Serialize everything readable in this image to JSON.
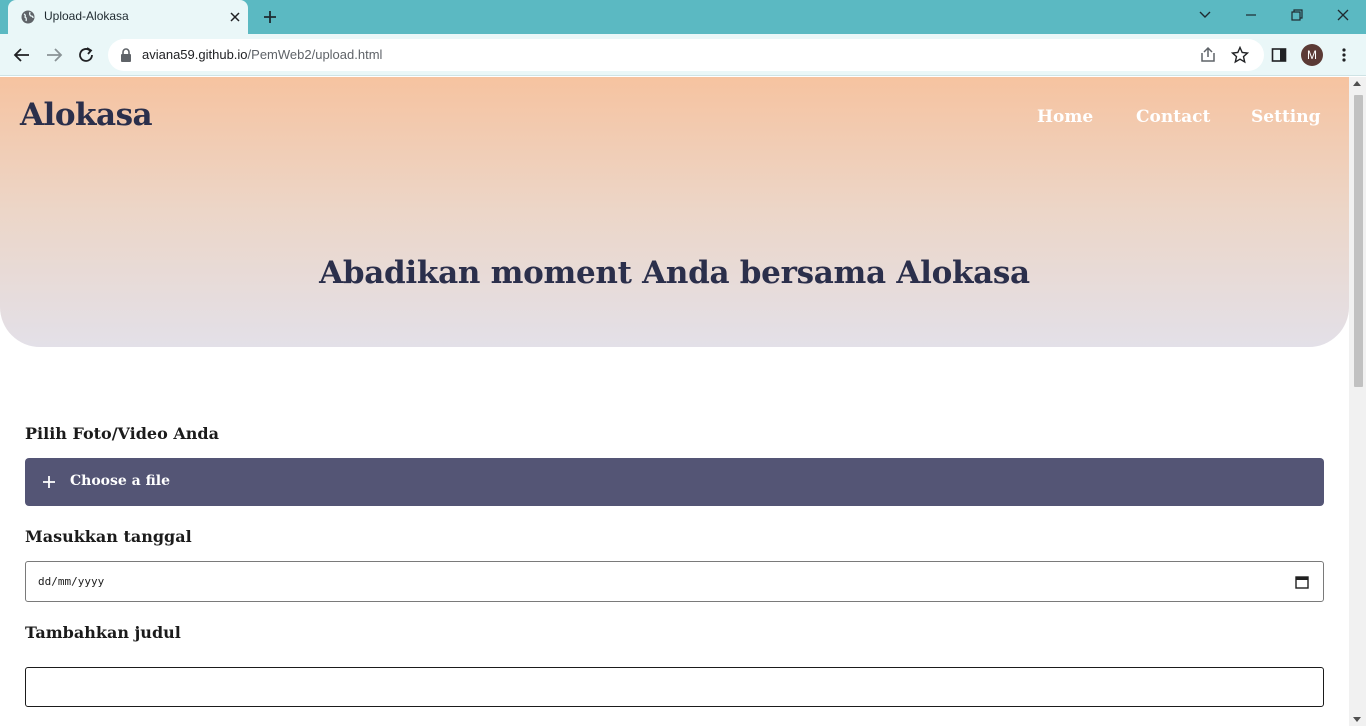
{
  "browser": {
    "tab_title": "Upload-Alokasa",
    "url_domain": "aviana59.github.io",
    "url_path": "/PemWeb2/upload.html",
    "profile_initial": "M"
  },
  "header": {
    "brand": "Alokasa",
    "nav": [
      {
        "label": "Home"
      },
      {
        "label": "Contact"
      },
      {
        "label": "Setting"
      }
    ]
  },
  "hero": {
    "title": "Abadikan moment Anda bersama Alokasa"
  },
  "form": {
    "file_label": "Pilih Foto/Video Anda",
    "file_button": "Choose a file",
    "date_label": "Masukkan tanggal",
    "date_placeholder": "dd/mm/yyyy",
    "title_label": "Tambahkan judul",
    "title_value": ""
  },
  "colors": {
    "tab_strip": "#5bb9c2",
    "hero_top": "#f6c3a0",
    "hero_bottom": "#e3e0e8",
    "heading": "#2b2f4b",
    "file_button": "#545575"
  }
}
